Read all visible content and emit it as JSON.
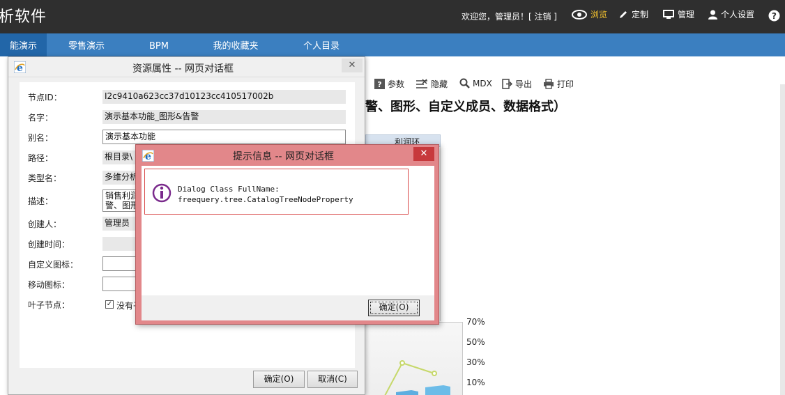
{
  "header": {
    "app_title": "析软件",
    "welcome": "欢迎您，管理员！[ 注销 ]",
    "nav": [
      {
        "label": "浏览",
        "icon": "eye-icon",
        "active": true
      },
      {
        "label": "定制",
        "icon": "pencil-icon",
        "active": false
      },
      {
        "label": "管理",
        "icon": "monitor-icon",
        "active": false
      },
      {
        "label": "个人设置",
        "icon": "user-icon",
        "active": false
      }
    ],
    "help_icon": "help-icon"
  },
  "menu": {
    "items": [
      {
        "label": "能演示",
        "active": true
      },
      {
        "label": "零售演示",
        "active": false
      },
      {
        "label": "BPM",
        "active": false
      },
      {
        "label": "我的收藏夹",
        "active": false
      },
      {
        "label": "个人目录",
        "active": false
      }
    ]
  },
  "report": {
    "toolbar": [
      {
        "label": "参数",
        "icon": "question-box-icon"
      },
      {
        "label": "隐藏",
        "icon": "hide-icon"
      },
      {
        "label": "MDX",
        "icon": "magnifier-icon"
      },
      {
        "label": "导出",
        "icon": "export-icon"
      },
      {
        "label": "打印",
        "icon": "printer-icon"
      }
    ],
    "title": "警、图形、自定义成员、数据格式）",
    "grid_header": "利润环",
    "chart_ticks": [
      "70%",
      "50%",
      "30%",
      "10%"
    ],
    "chart_data": {
      "type": "line",
      "y_ticks": [
        "70%",
        "50%",
        "30%",
        "10%"
      ],
      "note": "partially hidden combo chart"
    }
  },
  "resource_dialog": {
    "title": "资源属性 -- 网页对话框",
    "fields": [
      {
        "label": "节点ID：",
        "value": "I2c9410a623cc37d10123cc410517002b",
        "kind": "readonly"
      },
      {
        "label": "名字：",
        "value": "演示基本功能_图形&告警",
        "kind": "readonly"
      },
      {
        "label": "别名：",
        "value": "演示基本功能",
        "kind": "input"
      },
      {
        "label": "路径：",
        "value": "根目录\\",
        "kind": "readonly"
      },
      {
        "label": "类型名：",
        "value": "多维分析",
        "kind": "readonly"
      },
      {
        "label": "描述：",
        "value": "销售利润\n警、图形",
        "kind": "textarea"
      },
      {
        "label": "创建人：",
        "value": "管理员",
        "kind": "readonly"
      },
      {
        "label": "创建时间：",
        "value": "",
        "kind": "readonly"
      },
      {
        "label": "自定义图标：",
        "value": "",
        "kind": "input"
      },
      {
        "label": "移动图标：",
        "value": "",
        "kind": "input"
      },
      {
        "label": "叶子节点：",
        "value": "没有子",
        "kind": "checkbox",
        "checked": true
      }
    ],
    "ok_label": "确定(O)",
    "cancel_label": "取消(C)",
    "close_label": "✕"
  },
  "message_dialog": {
    "title": "提示信息 -- 网页对话框",
    "line1": "Dialog Class FullName:",
    "line2": "freequery.tree.CatalogTreeNodeProperty",
    "ok_label": "确定(O)",
    "close_label": "✕",
    "accent": "#7a2a8c"
  }
}
